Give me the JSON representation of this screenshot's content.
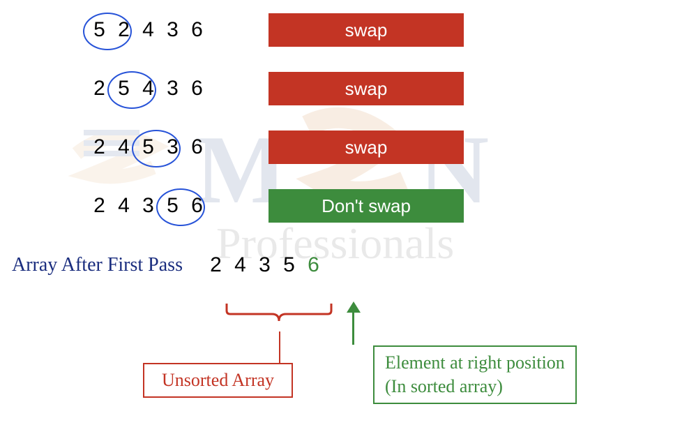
{
  "steps": [
    {
      "array": [
        "5",
        "2",
        "4",
        "3",
        "6"
      ],
      "circle_start_index": 0,
      "action": "swap",
      "style": "swap"
    },
    {
      "array": [
        "2",
        "5",
        "4",
        "3",
        "6"
      ],
      "circle_start_index": 1,
      "action": "swap",
      "style": "swap"
    },
    {
      "array": [
        "2",
        "4",
        "5",
        "3",
        "6"
      ],
      "circle_start_index": 2,
      "action": "swap",
      "style": "swap"
    },
    {
      "array": [
        "2",
        "4",
        "3",
        "5",
        "6"
      ],
      "circle_start_index": 3,
      "action": "Don't swap",
      "style": "noswap"
    }
  ],
  "result_label": "Array After First Pass",
  "result_array": [
    "2",
    "4",
    "3",
    "5",
    "6"
  ],
  "result_sorted_from_index": 4,
  "labels": {
    "unsorted": "Unsorted Array",
    "sorted_line1": "Element at right position",
    "sorted_line2": "(In sorted array)"
  },
  "watermark": {
    "text_top": "M  N",
    "text_bottom": "Professionals"
  }
}
